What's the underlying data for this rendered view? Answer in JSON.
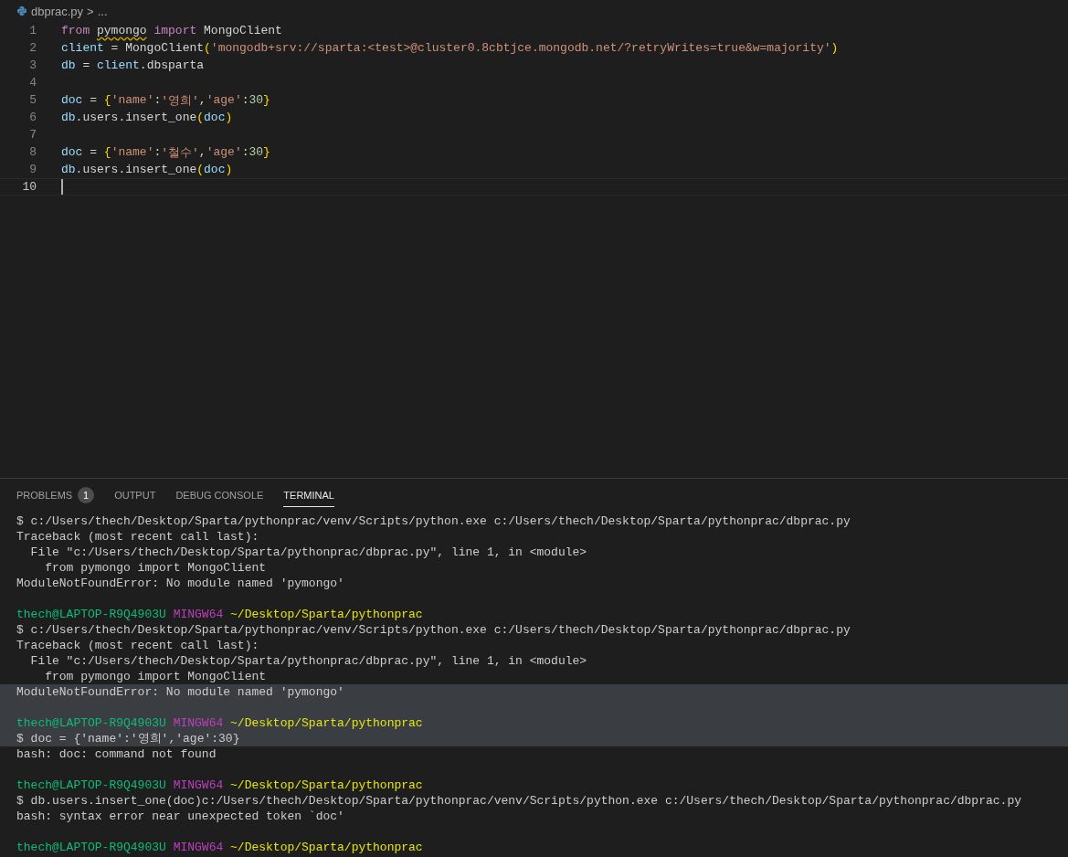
{
  "breadcrumb": {
    "file": "dbprac.py",
    "separator": ">",
    "more": "..."
  },
  "editor": {
    "lines": [
      {
        "number": "1",
        "current": false,
        "tokens": [
          {
            "kind": "kw",
            "text": "from "
          },
          {
            "kind": "warn",
            "text": "pymongo"
          },
          {
            "kind": "kw",
            "text": " import"
          },
          {
            "kind": "plain",
            "text": " MongoClient"
          }
        ]
      },
      {
        "number": "2",
        "current": false,
        "tokens": [
          {
            "kind": "var",
            "text": "client"
          },
          {
            "kind": "plain",
            "text": " = MongoClient"
          },
          {
            "kind": "brace",
            "text": "("
          },
          {
            "kind": "str",
            "text": "'mongodb+srv://sparta:<test>@cluster0.8cbtjce.mongodb.net/?retryWrites=true&w=majority'"
          },
          {
            "kind": "brace",
            "text": ")"
          }
        ]
      },
      {
        "number": "3",
        "current": false,
        "tokens": [
          {
            "kind": "var",
            "text": "db"
          },
          {
            "kind": "plain",
            "text": " = "
          },
          {
            "kind": "var",
            "text": "client"
          },
          {
            "kind": "plain",
            "text": ".dbsparta"
          }
        ]
      },
      {
        "number": "4",
        "current": false
      },
      {
        "number": "5",
        "current": false,
        "tokens": [
          {
            "kind": "var",
            "text": "doc"
          },
          {
            "kind": "plain",
            "text": " = "
          },
          {
            "kind": "brace",
            "text": "{"
          },
          {
            "kind": "str",
            "text": "'name'"
          },
          {
            "kind": "plain",
            "text": ":"
          },
          {
            "kind": "str",
            "text": "'영희'"
          },
          {
            "kind": "plain",
            "text": ","
          },
          {
            "kind": "str",
            "text": "'age'"
          },
          {
            "kind": "plain",
            "text": ":"
          },
          {
            "kind": "num",
            "text": "30"
          },
          {
            "kind": "brace",
            "text": "}"
          }
        ]
      },
      {
        "number": "6",
        "current": false,
        "tokens": [
          {
            "kind": "var",
            "text": "db"
          },
          {
            "kind": "plain",
            "text": ".users.insert_one"
          },
          {
            "kind": "brace",
            "text": "("
          },
          {
            "kind": "var",
            "text": "doc"
          },
          {
            "kind": "brace",
            "text": ")"
          }
        ]
      },
      {
        "number": "7",
        "current": false
      },
      {
        "number": "8",
        "current": false,
        "tokens": [
          {
            "kind": "var",
            "text": "doc"
          },
          {
            "kind": "plain",
            "text": " = "
          },
          {
            "kind": "brace",
            "text": "{"
          },
          {
            "kind": "str",
            "text": "'name'"
          },
          {
            "kind": "plain",
            "text": ":"
          },
          {
            "kind": "str",
            "text": "'철수'"
          },
          {
            "kind": "plain",
            "text": ","
          },
          {
            "kind": "str",
            "text": "'age'"
          },
          {
            "kind": "plain",
            "text": ":"
          },
          {
            "kind": "num",
            "text": "30"
          },
          {
            "kind": "brace",
            "text": "}"
          }
        ]
      },
      {
        "number": "9",
        "current": false,
        "tokens": [
          {
            "kind": "var",
            "text": "db"
          },
          {
            "kind": "plain",
            "text": ".users.insert_one"
          },
          {
            "kind": "brace",
            "text": "("
          },
          {
            "kind": "var",
            "text": "doc"
          },
          {
            "kind": "brace",
            "text": ")"
          }
        ]
      },
      {
        "number": "10",
        "current": true
      }
    ]
  },
  "panel": {
    "tabs": [
      {
        "label": "PROBLEMS",
        "badge": "1",
        "selected": false
      },
      {
        "label": "OUTPUT",
        "selected": false
      },
      {
        "label": "DEBUG CONSOLE",
        "selected": false
      },
      {
        "label": "TERMINAL",
        "selected": true
      }
    ]
  },
  "terminal": {
    "lines": [
      {
        "kind": "output",
        "highlighted": false,
        "text": "$ c:/Users/thech/Desktop/Sparta/pythonprac/venv/Scripts/python.exe c:/Users/thech/Desktop/Sparta/pythonprac/dbprac.py"
      },
      {
        "kind": "output",
        "highlighted": false,
        "text": "Traceback (most recent call last):"
      },
      {
        "kind": "output",
        "highlighted": false,
        "text": "  File \"c:/Users/thech/Desktop/Sparta/pythonprac/dbprac.py\", line 1, in <module>"
      },
      {
        "kind": "output",
        "highlighted": false,
        "text": "    from pymongo import MongoClient"
      },
      {
        "kind": "output",
        "highlighted": false,
        "text": "ModuleNotFoundError: No module named 'pymongo'"
      },
      {
        "kind": "blank",
        "highlighted": false
      },
      {
        "kind": "prompt",
        "highlighted": false,
        "user": "thech@LAPTOP-R9Q4903U",
        "system": "MINGW64",
        "path": "~/Desktop/Sparta/pythonprac"
      },
      {
        "kind": "output",
        "highlighted": false,
        "text": "$ c:/Users/thech/Desktop/Sparta/pythonprac/venv/Scripts/python.exe c:/Users/thech/Desktop/Sparta/pythonprac/dbprac.py"
      },
      {
        "kind": "output",
        "highlighted": false,
        "text": "Traceback (most recent call last):"
      },
      {
        "kind": "output",
        "highlighted": false,
        "text": "  File \"c:/Users/thech/Desktop/Sparta/pythonprac/dbprac.py\", line 1, in <module>"
      },
      {
        "kind": "output",
        "highlighted": false,
        "text": "    from pymongo import MongoClient"
      },
      {
        "kind": "output",
        "highlighted": true,
        "text": "ModuleNotFoundError: No module named 'pymongo'"
      },
      {
        "kind": "blank",
        "highlighted": true
      },
      {
        "kind": "prompt",
        "highlighted": true,
        "user": "thech@LAPTOP-R9Q4903U",
        "system": "MINGW64",
        "path": "~/Desktop/Sparta/pythonprac"
      },
      {
        "kind": "output",
        "highlighted": true,
        "text": "$ doc = {'name':'영희','age':30}"
      },
      {
        "kind": "output",
        "highlighted": false,
        "text": "bash: doc: command not found"
      },
      {
        "kind": "blank",
        "highlighted": false
      },
      {
        "kind": "prompt",
        "highlighted": false,
        "user": "thech@LAPTOP-R9Q4903U",
        "system": "MINGW64",
        "path": "~/Desktop/Sparta/pythonprac"
      },
      {
        "kind": "output",
        "highlighted": false,
        "text": "$ db.users.insert_one(doc)c:/Users/thech/Desktop/Sparta/pythonprac/venv/Scripts/python.exe c:/Users/thech/Desktop/Sparta/pythonprac/dbprac.py"
      },
      {
        "kind": "output",
        "highlighted": false,
        "text": "bash: syntax error near unexpected token `doc'"
      },
      {
        "kind": "blank",
        "highlighted": false
      },
      {
        "kind": "prompt",
        "highlighted": false,
        "user": "thech@LAPTOP-R9Q4903U",
        "system": "MINGW64",
        "path": "~/Desktop/Sparta/pythonprac"
      }
    ]
  }
}
